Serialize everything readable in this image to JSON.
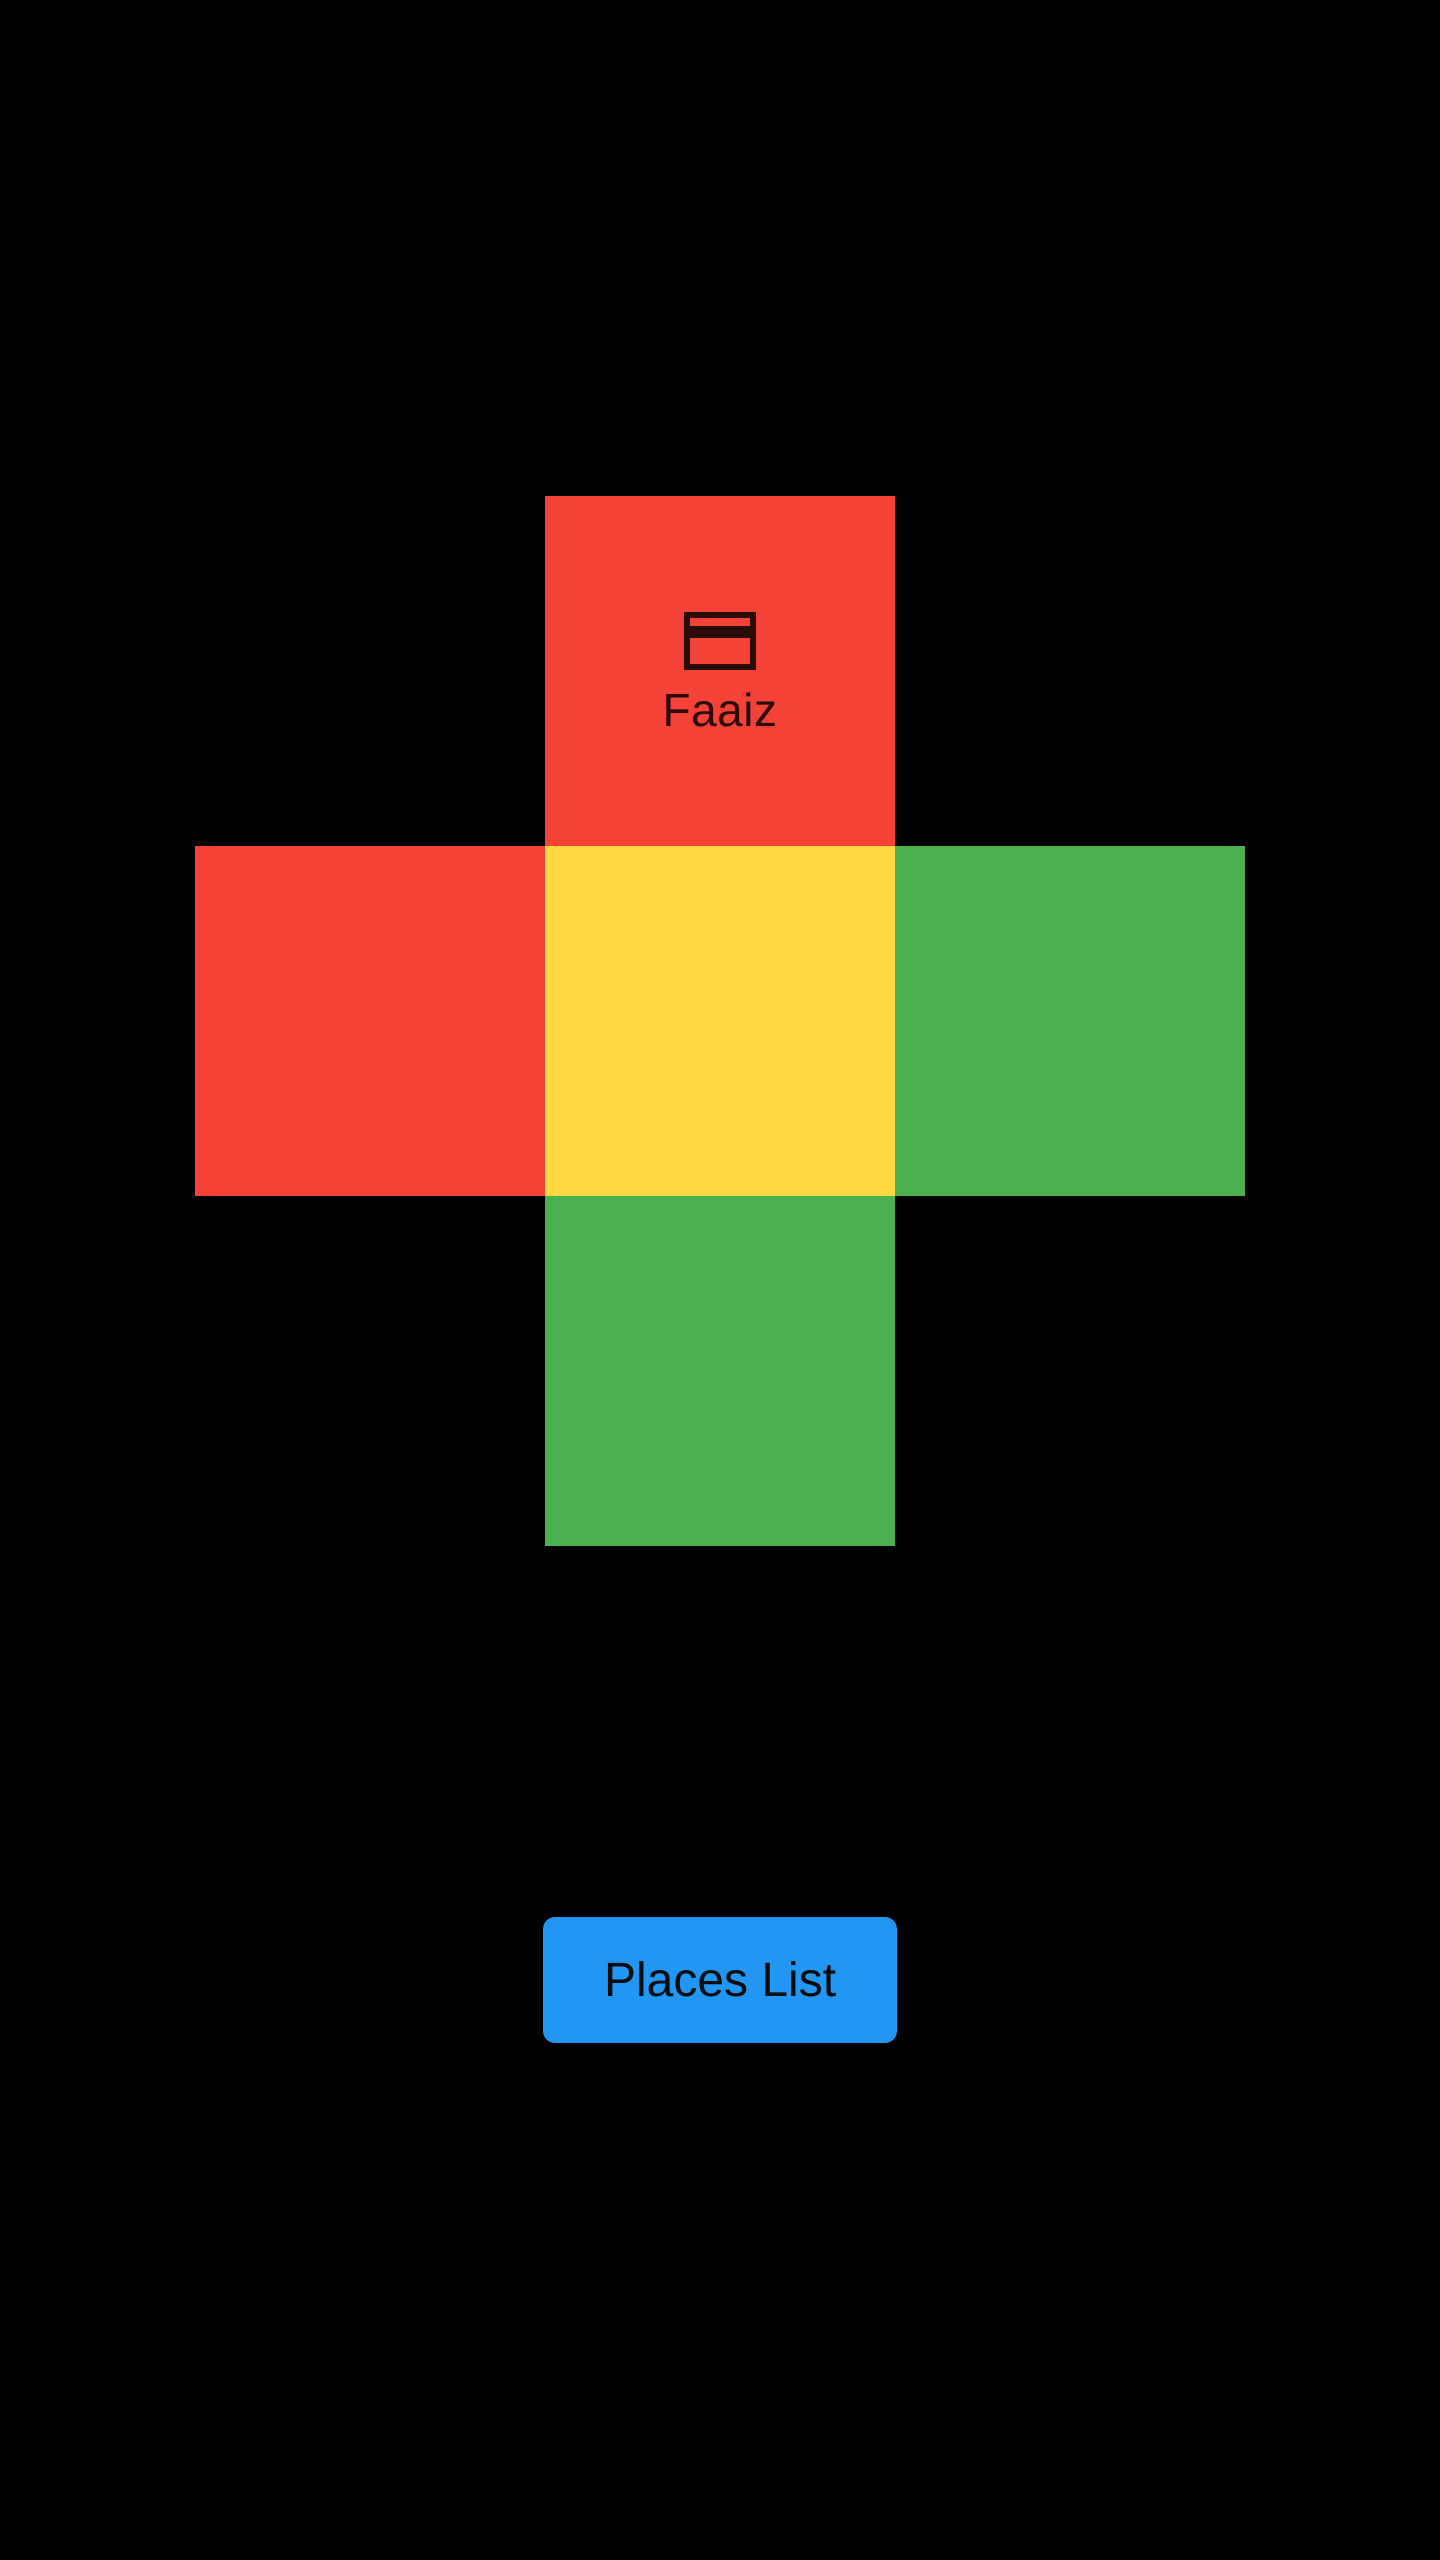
{
  "tiles": {
    "top": {
      "color": "#F44336",
      "icon": "credit-card-icon",
      "label": "Faaiz"
    },
    "left": {
      "color": "#F44336"
    },
    "center": {
      "color": "#FFD740"
    },
    "right": {
      "color": "#4CAF50"
    },
    "bottom": {
      "color": "#4CAF50"
    }
  },
  "button": {
    "label": "Places List",
    "color": "#2196F3"
  }
}
